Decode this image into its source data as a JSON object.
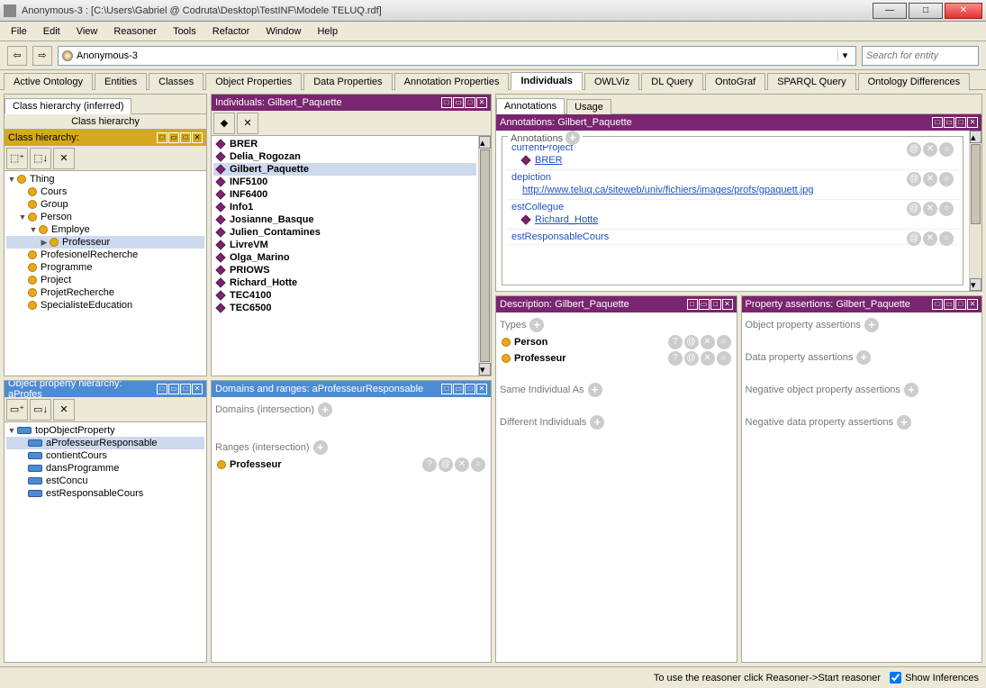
{
  "window": {
    "title": "Anonymous-3 : [C:\\Users\\Gabriel @ Codruta\\Desktop\\TestINF\\Modele TELUQ.rdf]"
  },
  "menu": [
    "File",
    "Edit",
    "View",
    "Reasoner",
    "Tools",
    "Refactor",
    "Window",
    "Help"
  ],
  "address": "Anonymous-3",
  "search_placeholder": "Search for entity",
  "tabs": [
    "Active Ontology",
    "Entities",
    "Classes",
    "Object Properties",
    "Data Properties",
    "Annotation Properties",
    "Individuals",
    "OWLViz",
    "DL Query",
    "OntoGraf",
    "SPARQL Query",
    "Ontology Differences"
  ],
  "active_tab": "Individuals",
  "class_hierarchy_inferred_tab": "Class hierarchy (inferred)",
  "class_hierarchy_tab": "Class hierarchy",
  "class_hierarchy_header": "Class hierarchy:",
  "classes": {
    "root": "Thing",
    "children": [
      "Cours",
      "Group",
      "Person",
      "ProfesionelRecherche",
      "Programme",
      "Project",
      "ProjetRecherche",
      "SpecialisteEducation"
    ],
    "person_children": [
      "Employe"
    ],
    "employe_children": [
      "Professeur"
    ]
  },
  "obj_prop_header": "Object property hierarchy: aProfes",
  "obj_prop_root": "topObjectProperty",
  "obj_props": [
    "aProfesseurResponsable",
    "contientCours",
    "dansProgramme",
    "estConcu",
    "estResponsableCours"
  ],
  "obj_prop_selected": "aProfesseurResponsable",
  "individuals_header": "Individuals: Gilbert_Paquette",
  "individuals": [
    "BRER",
    "Delia_Rogozan",
    "Gilbert_Paquette",
    "INF5100",
    "INF6400",
    "Info1",
    "Josianne_Basque",
    "Julien_Contamines",
    "LivreVM",
    "Olga_Marino",
    "PRIOWS",
    "Richard_Hotte",
    "TEC4100",
    "TEC6500"
  ],
  "individual_selected": "Gilbert_Paquette",
  "domains_header": "Domains and ranges: aProfesseurResponsable",
  "domains_label": "Domains (intersection)",
  "ranges_label": "Ranges (intersection)",
  "ranges_value": "Professeur",
  "annotations_tabs": [
    "Annotations",
    "Usage"
  ],
  "annotations_active": "Annotations",
  "annotations_header": "Annotations: Gilbert_Paquette",
  "annotations_section": "Annotations",
  "annotations": [
    {
      "prop": "currentProject",
      "val": "BRER",
      "kind": "ind"
    },
    {
      "prop": "depiction",
      "val": "http://www.teluq.ca/siteweb/univ/fichiers/images/profs/gpaquett.jpg",
      "kind": "link"
    },
    {
      "prop": "estCollegue",
      "val": "Richard_Hotte",
      "kind": "ind"
    },
    {
      "prop": "estResponsableCours",
      "val": "",
      "kind": "partial"
    }
  ],
  "description_header": "Description: Gilbert_Paquette",
  "types_label": "Types",
  "types": [
    "Person",
    "Professeur"
  ],
  "same_as_label": "Same Individual As",
  "diff_label": "Different Individuals",
  "assertions_header": "Property assertions: Gilbert_Paquette",
  "assert_labels": [
    "Object property assertions",
    "Data property assertions",
    "Negative object property assertions",
    "Negative data property assertions"
  ],
  "status_text": "To use the reasoner click Reasoner->Start reasoner",
  "show_inferences_label": "Show Inferences"
}
